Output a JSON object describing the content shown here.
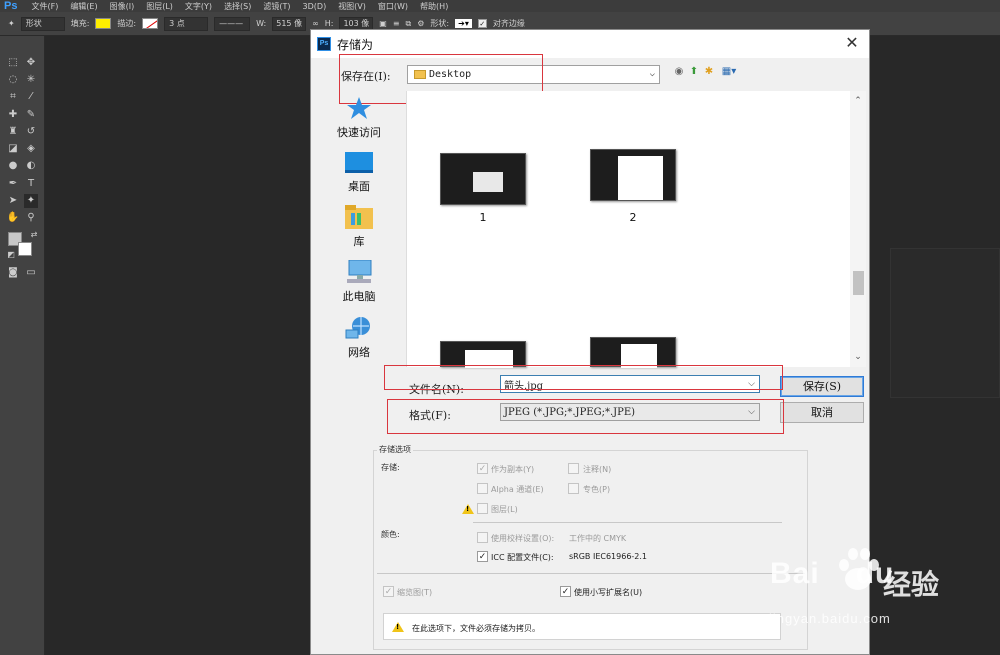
{
  "app": {
    "logo": "Ps",
    "menu": [
      "文件(F)",
      "编辑(E)",
      "图像(I)",
      "图层(L)",
      "文字(Y)",
      "选择(S)",
      "滤镜(T)",
      "3D(D)",
      "视图(V)",
      "窗口(W)",
      "帮助(H)"
    ]
  },
  "options_bar": {
    "mode": "形状",
    "fill_label": "填充:",
    "stroke_label": "描边:",
    "stroke_size": "3 点",
    "w_label": "W:",
    "w_value": "515 像",
    "h_label": "H:",
    "h_value": "103 像",
    "shape_label": "形状:",
    "align_edges": "对齐边缘",
    "fill_color": "#ffee00"
  },
  "dialog": {
    "title": "存储为",
    "save_in_label": "保存在(I):",
    "save_in_value": "Desktop",
    "places": [
      "快速访问",
      "桌面",
      "库",
      "此电脑",
      "网络"
    ],
    "files": [
      "1",
      "2"
    ],
    "filename_label": "文件名(N):",
    "filename_value": "箭头.jpg",
    "format_label": "格式(F):",
    "format_value": "JPEG (*.JPG;*.JPEG;*.JPE)",
    "save_button": "保存(S)",
    "cancel_button": "取消",
    "options": {
      "legend": "存储选项",
      "save_label": "存储:",
      "as_copy": "作为副本(Y)",
      "notes": "注释(N)",
      "alpha": "Alpha 通道(E)",
      "spot": "专色(P)",
      "layers": "图层(L)",
      "color_label": "颜色:",
      "proof": "使用校样设置(O):",
      "proof_value": "工作中的 CMYK",
      "icc": "ICC 配置文件(C):",
      "icc_value": "sRGB IEC61966-2.1",
      "thumbnail": "缩览图(T)",
      "lowercase_ext": "使用小写扩展名(U)",
      "notice": "在此选项下，文件必须存储为拷贝。"
    }
  },
  "watermark": {
    "logo": "Bai",
    "logo_suffix": "du",
    "brand": "经验",
    "url": "jingyan.baidu.com"
  }
}
